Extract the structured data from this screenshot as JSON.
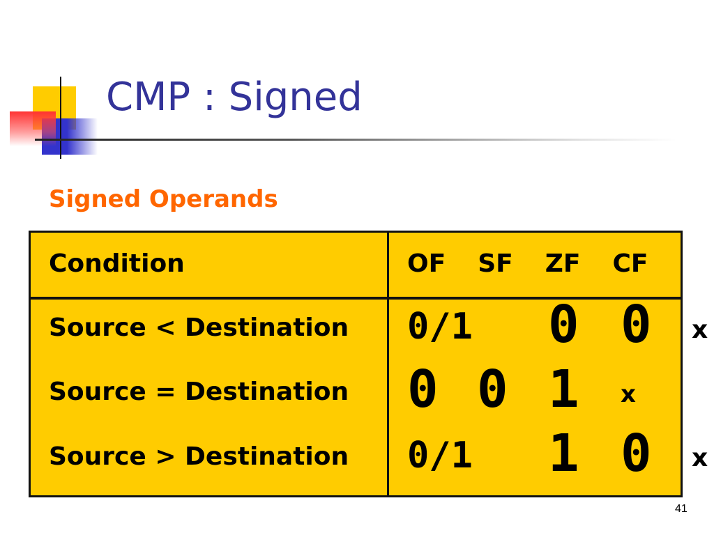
{
  "slide": {
    "title": "CMP : Signed",
    "subtitle": "Signed Operands",
    "number": "41"
  },
  "table": {
    "headers": {
      "condition": "Condition",
      "flags": [
        "OF",
        "SF",
        "ZF",
        "CF"
      ]
    },
    "rows": [
      {
        "condition": "Source < Destination",
        "of_sf": "0/1",
        "zf": "0",
        "cf": "0",
        "extra": "x"
      },
      {
        "condition": "Source = Destination",
        "of": "0",
        "sf": "0",
        "zf": "1",
        "cf": "x"
      },
      {
        "condition": "Source > Destination",
        "of_sf": "0/1",
        "zf": "1",
        "cf": "0",
        "extra": "x"
      }
    ]
  },
  "colors": {
    "title": "#333399",
    "subtitle": "#ff6600",
    "table_fill": "#ffcc00",
    "decor_yellow": "#ffcc00",
    "decor_blue": "#3333cc",
    "decor_red": "#ff3333"
  }
}
